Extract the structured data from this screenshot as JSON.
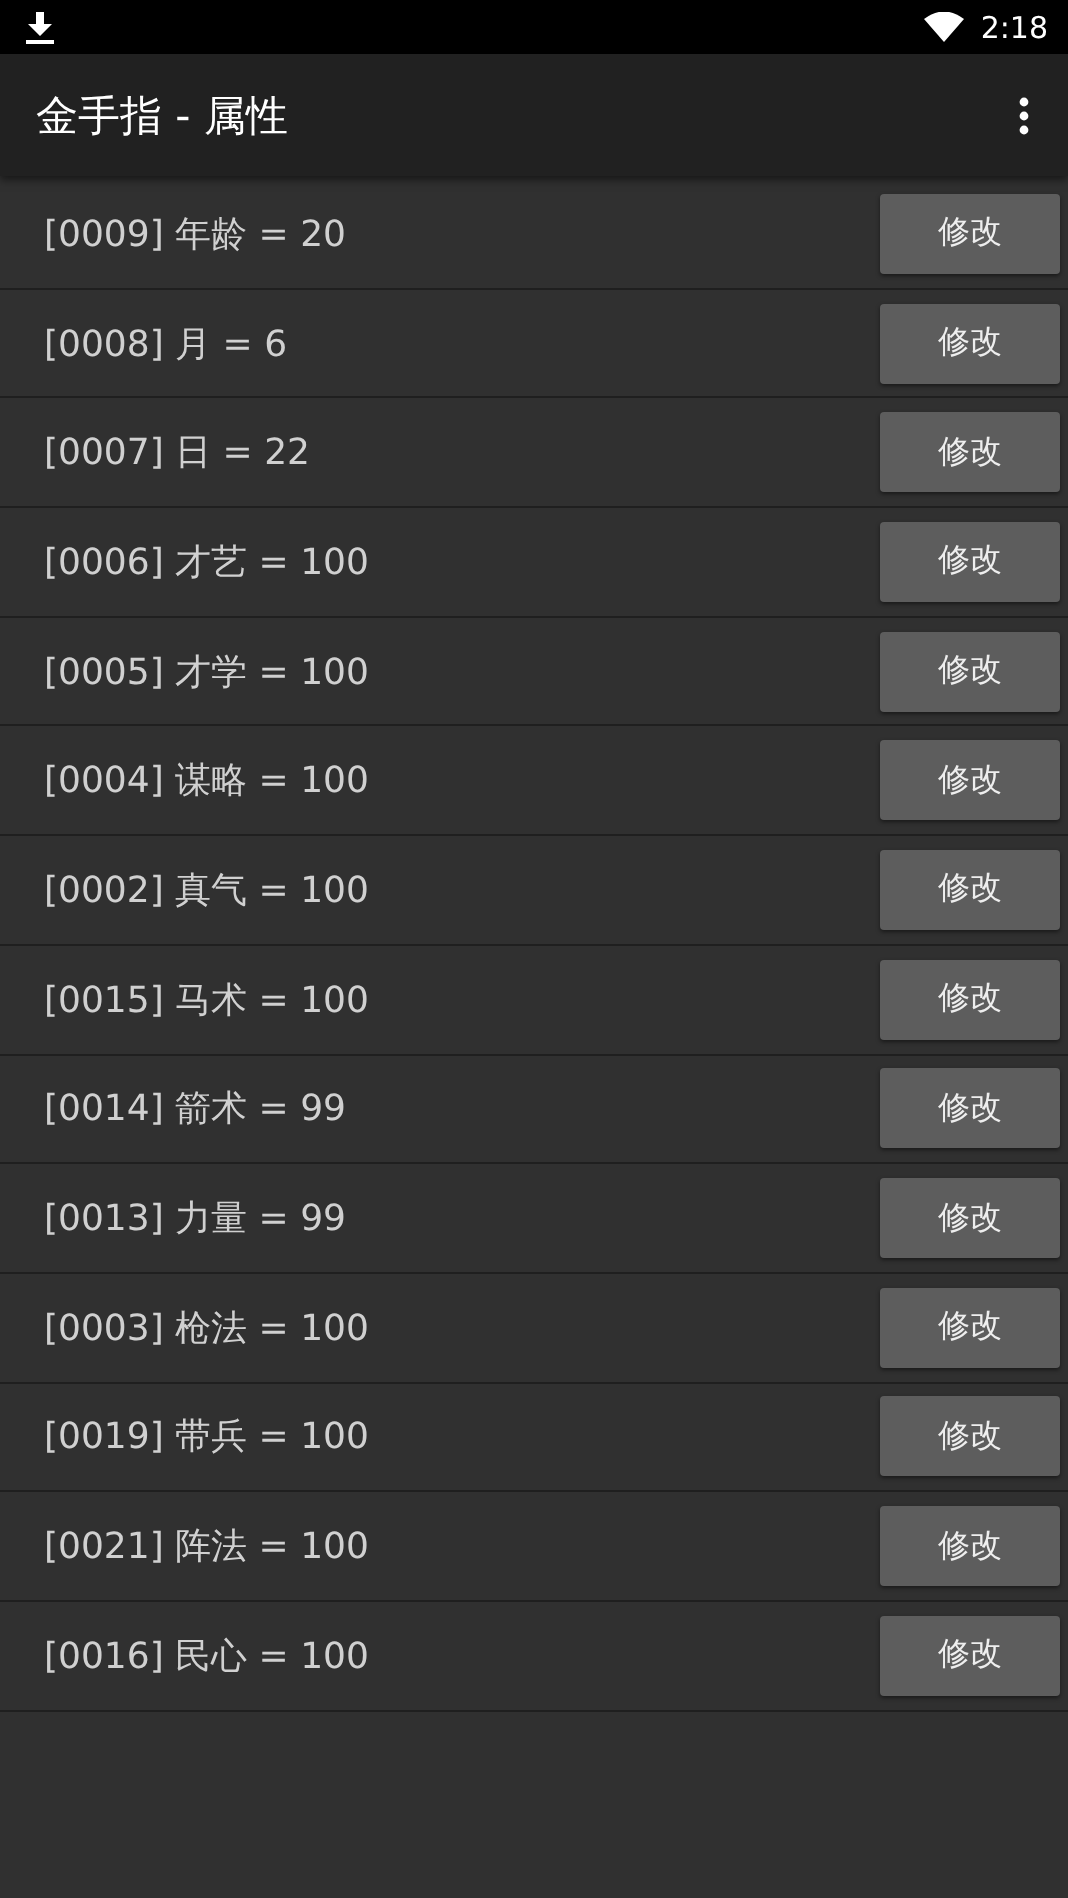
{
  "status_bar": {
    "time": "2:18"
  },
  "app_bar": {
    "title": "金手指 - 属性"
  },
  "rows": [
    {
      "label": "[0009] 年龄 = 20",
      "button": "修改"
    },
    {
      "label": "[0008] 月 = 6",
      "button": "修改"
    },
    {
      "label": "[0007] 日 = 22",
      "button": "修改"
    },
    {
      "label": "[0006] 才艺 = 100",
      "button": "修改"
    },
    {
      "label": "[0005] 才学 = 100",
      "button": "修改"
    },
    {
      "label": "[0004] 谋略 = 100",
      "button": "修改"
    },
    {
      "label": "[0002] 真气 = 100",
      "button": "修改"
    },
    {
      "label": "[0015] 马术 = 100",
      "button": "修改"
    },
    {
      "label": "[0014] 箭术 = 99",
      "button": "修改"
    },
    {
      "label": "[0013] 力量 = 99",
      "button": "修改"
    },
    {
      "label": "[0003] 枪法 = 100",
      "button": "修改"
    },
    {
      "label": "[0019] 带兵 = 100",
      "button": "修改"
    },
    {
      "label": "[0021] 阵法 = 100",
      "button": "修改"
    },
    {
      "label": "[0016] 民心 = 100",
      "button": "修改"
    }
  ]
}
